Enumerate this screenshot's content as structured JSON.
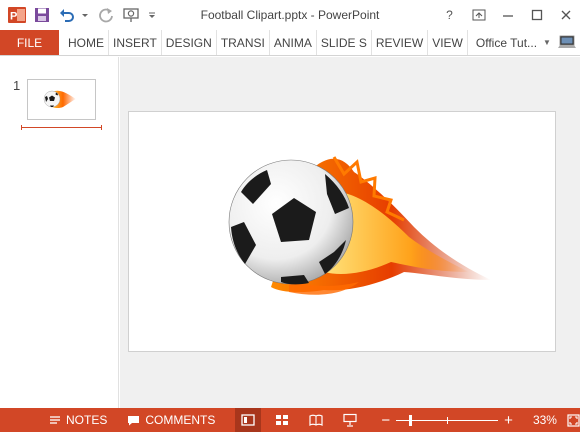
{
  "window": {
    "title": "Football Clipart.pptx - PowerPoint",
    "help_label": "?"
  },
  "ribbon": {
    "file_label": "FILE",
    "tabs": [
      "HOME",
      "INSERT",
      "DESIGN",
      "TRANSI",
      "ANIMA",
      "SLIDE S",
      "REVIEW",
      "VIEW"
    ],
    "account_label": "Office Tut..."
  },
  "thumbnails": {
    "slide_number": "1"
  },
  "statusbar": {
    "notes_label": "NOTES",
    "comments_label": "COMMENTS",
    "zoom_label": "33%",
    "zoom_fraction": 0.33
  },
  "colors": {
    "accent": "#d24726",
    "active_view": "#a8361c"
  }
}
